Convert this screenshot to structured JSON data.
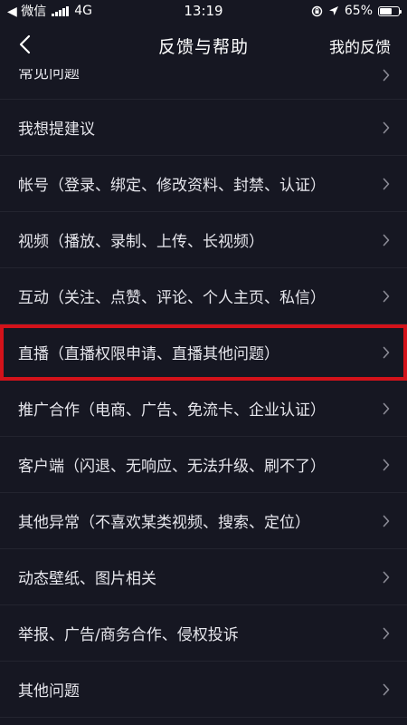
{
  "status_bar": {
    "carrier": "◀ 微信",
    "network": "4G",
    "time": "13:19",
    "battery_text": "65%",
    "battery_level": 0.65
  },
  "nav": {
    "title": "反馈与帮助",
    "right_label": "我的反馈"
  },
  "items": [
    {
      "label": "常见问题"
    },
    {
      "label": "我想提建议"
    },
    {
      "label": "帐号（登录、绑定、修改资料、封禁、认证）"
    },
    {
      "label": "视频（播放、录制、上传、长视频）"
    },
    {
      "label": "互动（关注、点赞、评论、个人主页、私信）"
    },
    {
      "label": "直播（直播权限申请、直播其他问题）",
      "highlighted": true
    },
    {
      "label": "推广合作（电商、广告、免流卡、企业认证）"
    },
    {
      "label": "客户端（闪退、无响应、无法升级、刷不了）"
    },
    {
      "label": "其他异常（不喜欢某类视频、搜索、定位）"
    },
    {
      "label": "动态壁纸、图片相关"
    },
    {
      "label": "举报、广告/商务合作、侵权投诉"
    },
    {
      "label": "其他问题"
    }
  ],
  "colors": {
    "background": "#161722",
    "highlight_border": "#d3121a",
    "chevron": "#8a8a95"
  }
}
